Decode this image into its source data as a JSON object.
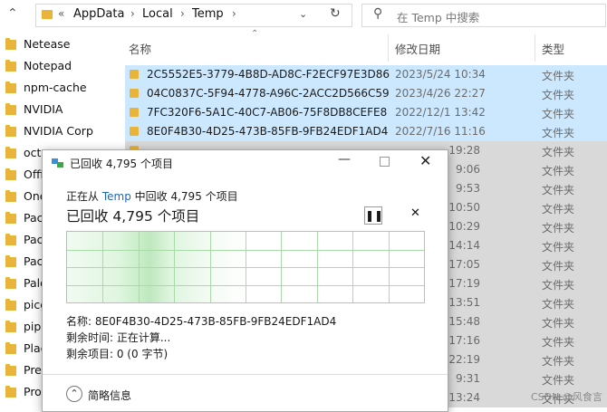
{
  "addressbar": {
    "path": [
      "AppData",
      "Local",
      "Temp"
    ],
    "search_placeholder": "在 Temp 中搜索"
  },
  "sidebar": {
    "items": [
      {
        "label": "Netease"
      },
      {
        "label": "Notepad"
      },
      {
        "label": "npm-cache"
      },
      {
        "label": "NVIDIA"
      },
      {
        "label": "NVIDIA Corp"
      },
      {
        "label": "oct"
      },
      {
        "label": "Offi"
      },
      {
        "label": "One"
      },
      {
        "label": "Pac"
      },
      {
        "label": "Pac"
      },
      {
        "label": "Pac"
      },
      {
        "label": "Palo"
      },
      {
        "label": "picg"
      },
      {
        "label": "pip"
      },
      {
        "label": "Plac"
      },
      {
        "label": "Pre"
      },
      {
        "label": "Pro"
      }
    ]
  },
  "filelist": {
    "columns": {
      "name": "名称",
      "date": "修改日期",
      "type": "类型"
    },
    "rows": [
      {
        "name": "2C5552E5-3779-4B8D-AD8C-F2ECF97E3D86",
        "date": "2023/5/24 10:34",
        "type": "文件夹"
      },
      {
        "name": "04C0837C-5F94-4778-A96C-2ACC2D566C59",
        "date": "2023/4/26 22:27",
        "type": "文件夹"
      },
      {
        "name": "7FC320F6-5A1C-40C7-AB06-75F8DB8CEFE8",
        "date": "2022/12/1 13:42",
        "type": "文件夹"
      },
      {
        "name": "8E0F4B30-4D25-473B-85FB-9FB24EDF1AD4",
        "date": "2022/7/16 11:16",
        "type": "文件夹"
      },
      {
        "name": "",
        "date": "19:28",
        "type": "文件夹"
      },
      {
        "name": "",
        "date": "9:06",
        "type": "文件夹"
      },
      {
        "name": "",
        "date": "9:53",
        "type": "文件夹"
      },
      {
        "name": "",
        "date": "10:50",
        "type": "文件夹"
      },
      {
        "name": "",
        "date": "10:29",
        "type": "文件夹"
      },
      {
        "name": "",
        "date": "14:14",
        "type": "文件夹"
      },
      {
        "name": "",
        "date": "17:05",
        "type": "文件夹"
      },
      {
        "name": "",
        "date": "17:19",
        "type": "文件夹"
      },
      {
        "name": "",
        "date": "13:51",
        "type": "文件夹"
      },
      {
        "name": "",
        "date": "15:48",
        "type": "文件夹"
      },
      {
        "name": "",
        "date": "17:16",
        "type": "文件夹"
      },
      {
        "name": "",
        "date": "2 22:19",
        "type": "文件夹"
      },
      {
        "name": "",
        "date": "9:31",
        "type": "文件夹"
      },
      {
        "name": "",
        "date": "13:24",
        "type": "文件夹"
      }
    ]
  },
  "dialog": {
    "title": "已回收 4,795 个项目",
    "from_prefix": "正在从",
    "from_link": "Temp",
    "from_suffix": "中回收 4,795 个项目",
    "heading": "已回收 4,795 个项目",
    "progress": 0.33,
    "name_line": "名称:  8E0F4B30-4D25-473B-85FB-9FB24EDF1AD4",
    "time_line": "剩余时间:  正在计算...",
    "items_line": "剩余项目:  0 (0 字节)",
    "details_label": "简略信息"
  },
  "watermark": "CSDN @风食言"
}
